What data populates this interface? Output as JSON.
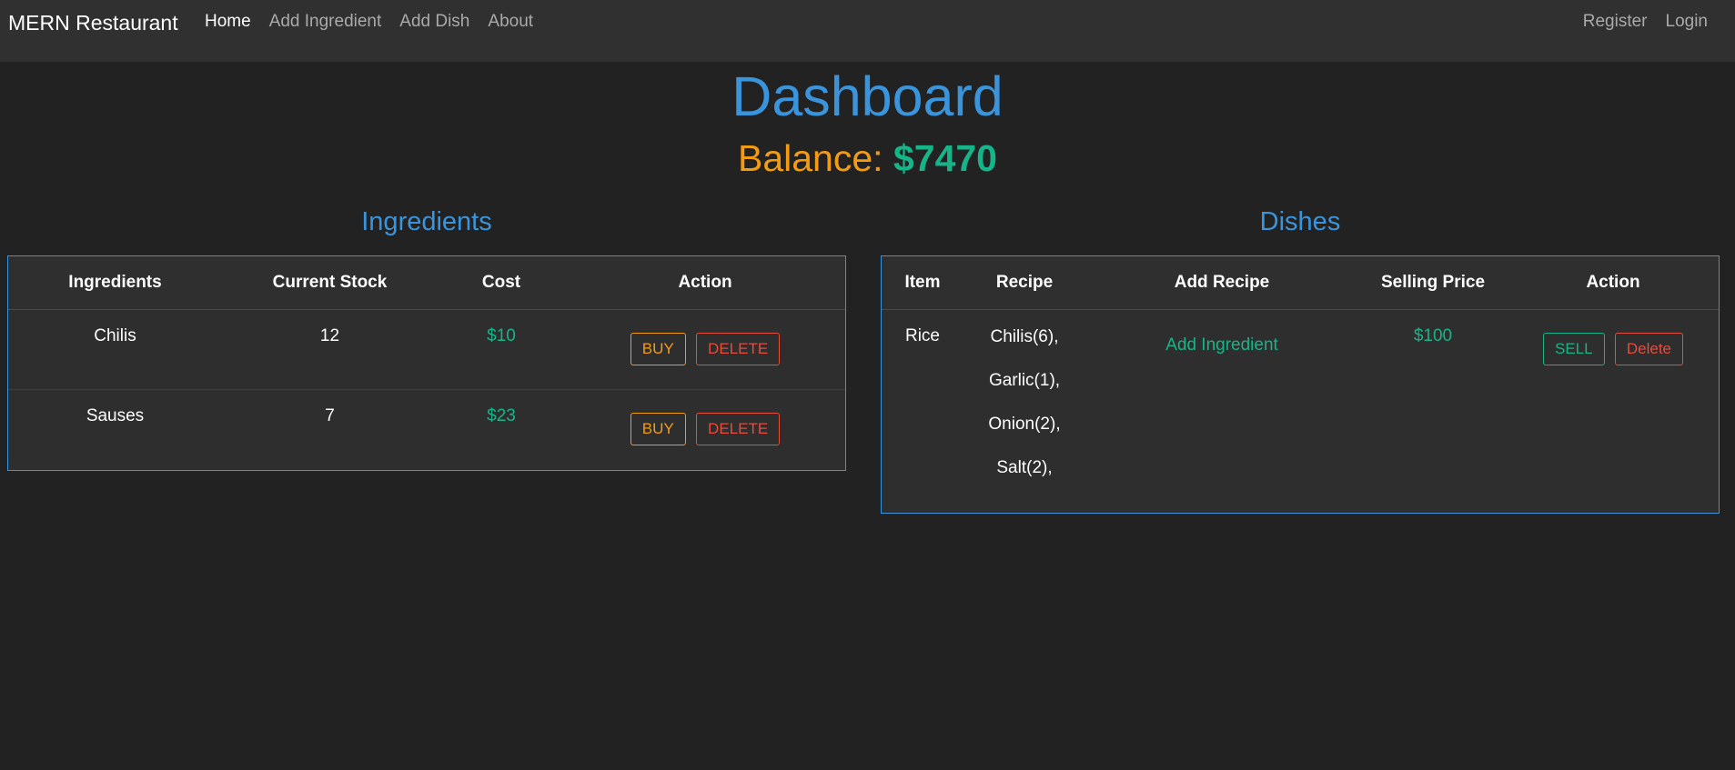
{
  "navbar": {
    "brand": "MERN Restaurant",
    "left_links": [
      "Home",
      "Add Ingredient",
      "Add Dish",
      "About"
    ],
    "right_links": [
      "Register",
      "Login"
    ]
  },
  "dashboard": {
    "title": "Dashboard",
    "balance_label": "Balance:",
    "balance_value": "$7470"
  },
  "ingredients": {
    "section_title": "Ingredients",
    "headers": [
      "Ingredients",
      "Current Stock",
      "Cost",
      "Action"
    ],
    "rows": [
      {
        "name": "Chilis",
        "stock": "12",
        "cost": "$10",
        "buy": "BUY",
        "delete": "DELETE"
      },
      {
        "name": "Sauses",
        "stock": "7",
        "cost": "$23",
        "buy": "BUY",
        "delete": "DELETE"
      }
    ]
  },
  "dishes": {
    "section_title": "Dishes",
    "headers": [
      "Item",
      "Recipe",
      "Add Recipe",
      "Selling Price",
      "Action"
    ],
    "rows": [
      {
        "item": "Rice",
        "recipe": [
          "Chilis(6),",
          "Garlic(1),",
          "Onion(2),",
          "Salt(2),"
        ],
        "add_recipe": "Add Ingredient",
        "price": "$100",
        "sell": "SELL",
        "delete": "Delete"
      }
    ]
  },
  "colors": {
    "accent_blue": "#3a94db",
    "green": "#16b489",
    "orange": "#f39c12",
    "red": "#e74c3c",
    "background": "#222222",
    "navbar": "#303030"
  }
}
